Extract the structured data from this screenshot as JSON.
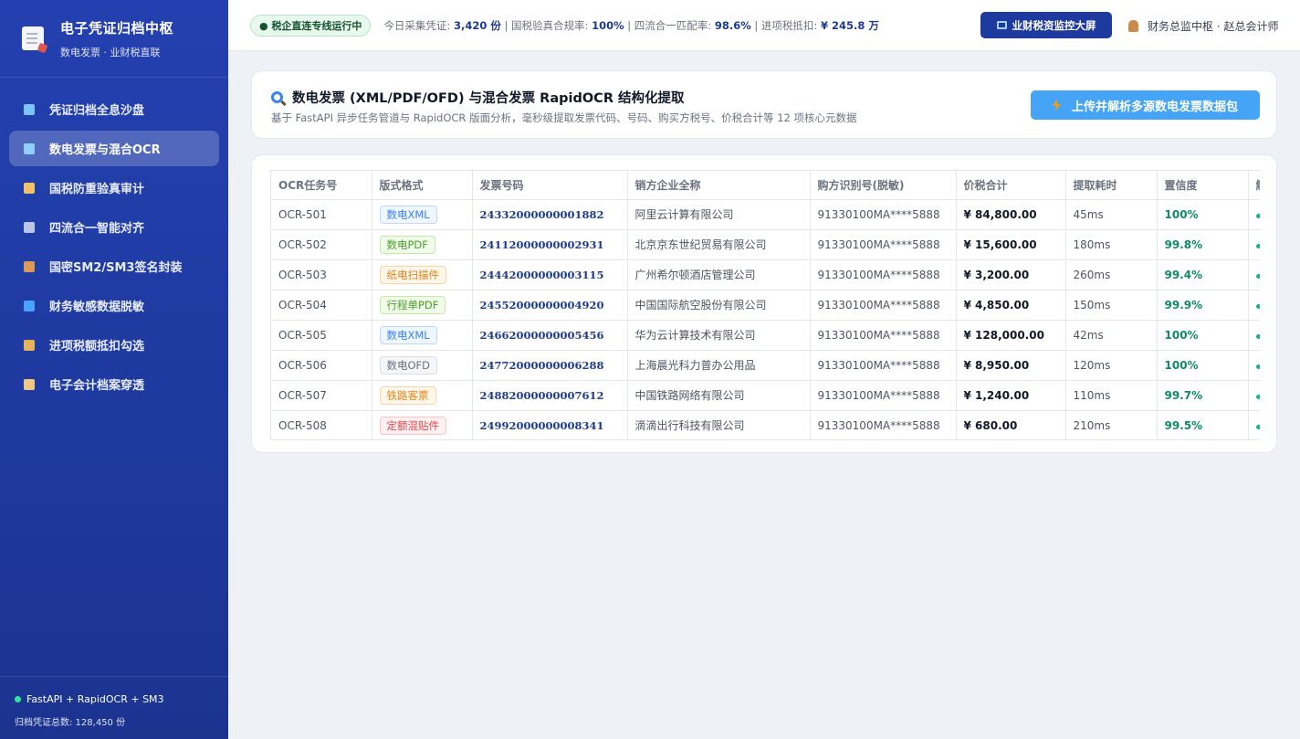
{
  "sidebar": {
    "brand_title": "电子凭证归档中枢",
    "brand_subtitle": "数电发票 · 业财税直联",
    "items": [
      {
        "label": "凭证归档全息沙盘",
        "icon": "chart-icon",
        "active": false
      },
      {
        "label": "数电发票与混合OCR",
        "icon": "search-icon",
        "active": true
      },
      {
        "label": "国税防重验真审计",
        "icon": "scale-icon",
        "active": false
      },
      {
        "label": "四流合一智能对齐",
        "icon": "link-icon",
        "active": false
      },
      {
        "label": "国密SM2/SM3签名封装",
        "icon": "briefcase-icon",
        "active": false
      },
      {
        "label": "财务敏感数据脱敏",
        "icon": "shield-icon",
        "active": false
      },
      {
        "label": "进项税额抵扣勾选",
        "icon": "money-bag-icon",
        "active": false
      },
      {
        "label": "电子会计档案穿透",
        "icon": "scroll-icon",
        "active": false
      }
    ],
    "footer_stack": "FastAPI + RapidOCR + SM3",
    "footer_total": "归档凭证总数: 128,450 份"
  },
  "topbar": {
    "status_badge": "● 税企直连专线运行中",
    "stat_1_label": "今日采集凭证: ",
    "stat_1_value": "3,420 份",
    "stat_2_label": " | 国税验真合规率: ",
    "stat_2_value": "100%",
    "stat_3_label": " | 四流合一匹配率: ",
    "stat_3_value": "98.6%",
    "stat_4_label": " | 进项税抵扣: ",
    "stat_4_value": "¥ 245.8 万",
    "monitor_button": "业财税资监控大屏",
    "user_label": "财务总监中枢 · 赵总会计师"
  },
  "header_card": {
    "title": "数电发票 (XML/PDF/OFD) 与混合发票 RapidOCR 结构化提取",
    "description": "基于 FastAPI 异步任务管道与 RapidOCR 版面分析，毫秒级提取发票代码、号码、购买方税号、价税合计等 12 项核心元数据",
    "upload_button": "上传并解析多源数电发票数据包"
  },
  "table": {
    "columns": [
      "OCR任务号",
      "版式格式",
      "发票号码",
      "销方企业全称",
      "购方识别号(脱敏)",
      "价税合计",
      "提取耗时",
      "置信度",
      "解"
    ],
    "rows": [
      {
        "task": "OCR-501",
        "format": "数电XML",
        "format_color": "blue",
        "invoice": "24332000000001882",
        "seller": "阿里云计算有限公司",
        "buyer_id": "91330100MA****5888",
        "amount": "¥ 84,800.00",
        "time": "45ms",
        "confidence": "100%"
      },
      {
        "task": "OCR-502",
        "format": "数电PDF",
        "format_color": "green",
        "invoice": "24112000000002931",
        "seller": "北京京东世纪贸易有限公司",
        "buyer_id": "91330100MA****5888",
        "amount": "¥ 15,600.00",
        "time": "180ms",
        "confidence": "99.8%"
      },
      {
        "task": "OCR-503",
        "format": "纸电扫描件",
        "format_color": "orange",
        "invoice": "24442000000003115",
        "seller": "广州希尔顿酒店管理公司",
        "buyer_id": "91330100MA****5888",
        "amount": "¥ 3,200.00",
        "time": "260ms",
        "confidence": "99.4%"
      },
      {
        "task": "OCR-504",
        "format": "行程单PDF",
        "format_color": "green",
        "invoice": "24552000000004920",
        "seller": "中国国际航空股份有限公司",
        "buyer_id": "91330100MA****5888",
        "amount": "¥ 4,850.00",
        "time": "150ms",
        "confidence": "99.9%"
      },
      {
        "task": "OCR-505",
        "format": "数电XML",
        "format_color": "blue",
        "invoice": "24662000000005456",
        "seller": "华为云计算技术有限公司",
        "buyer_id": "91330100MA****5888",
        "amount": "¥ 128,000.00",
        "time": "42ms",
        "confidence": "100%"
      },
      {
        "task": "OCR-506",
        "format": "数电OFD",
        "format_color": "gray",
        "invoice": "24772000000006288",
        "seller": "上海晨光科力普办公用品",
        "buyer_id": "91330100MA****5888",
        "amount": "¥ 8,950.00",
        "time": "120ms",
        "confidence": "100%"
      },
      {
        "task": "OCR-507",
        "format": "铁路客票",
        "format_color": "orange",
        "invoice": "24882000000007612",
        "seller": "中国铁路网络有限公司",
        "buyer_id": "91330100MA****5888",
        "amount": "¥ 1,240.00",
        "time": "110ms",
        "confidence": "99.7%"
      },
      {
        "task": "OCR-508",
        "format": "定额混贴件",
        "format_color": "red",
        "invoice": "24992000000008341",
        "seller": "滴滴出行科技有限公司",
        "buyer_id": "91330100MA****5888",
        "amount": "¥ 680.00",
        "time": "210ms",
        "confidence": "99.5%"
      }
    ]
  },
  "colors": {
    "sidebar_bg": "#2440b0",
    "accent": "#1e3a9f",
    "upload": "#45a4f6",
    "success": "#0f8a66"
  }
}
